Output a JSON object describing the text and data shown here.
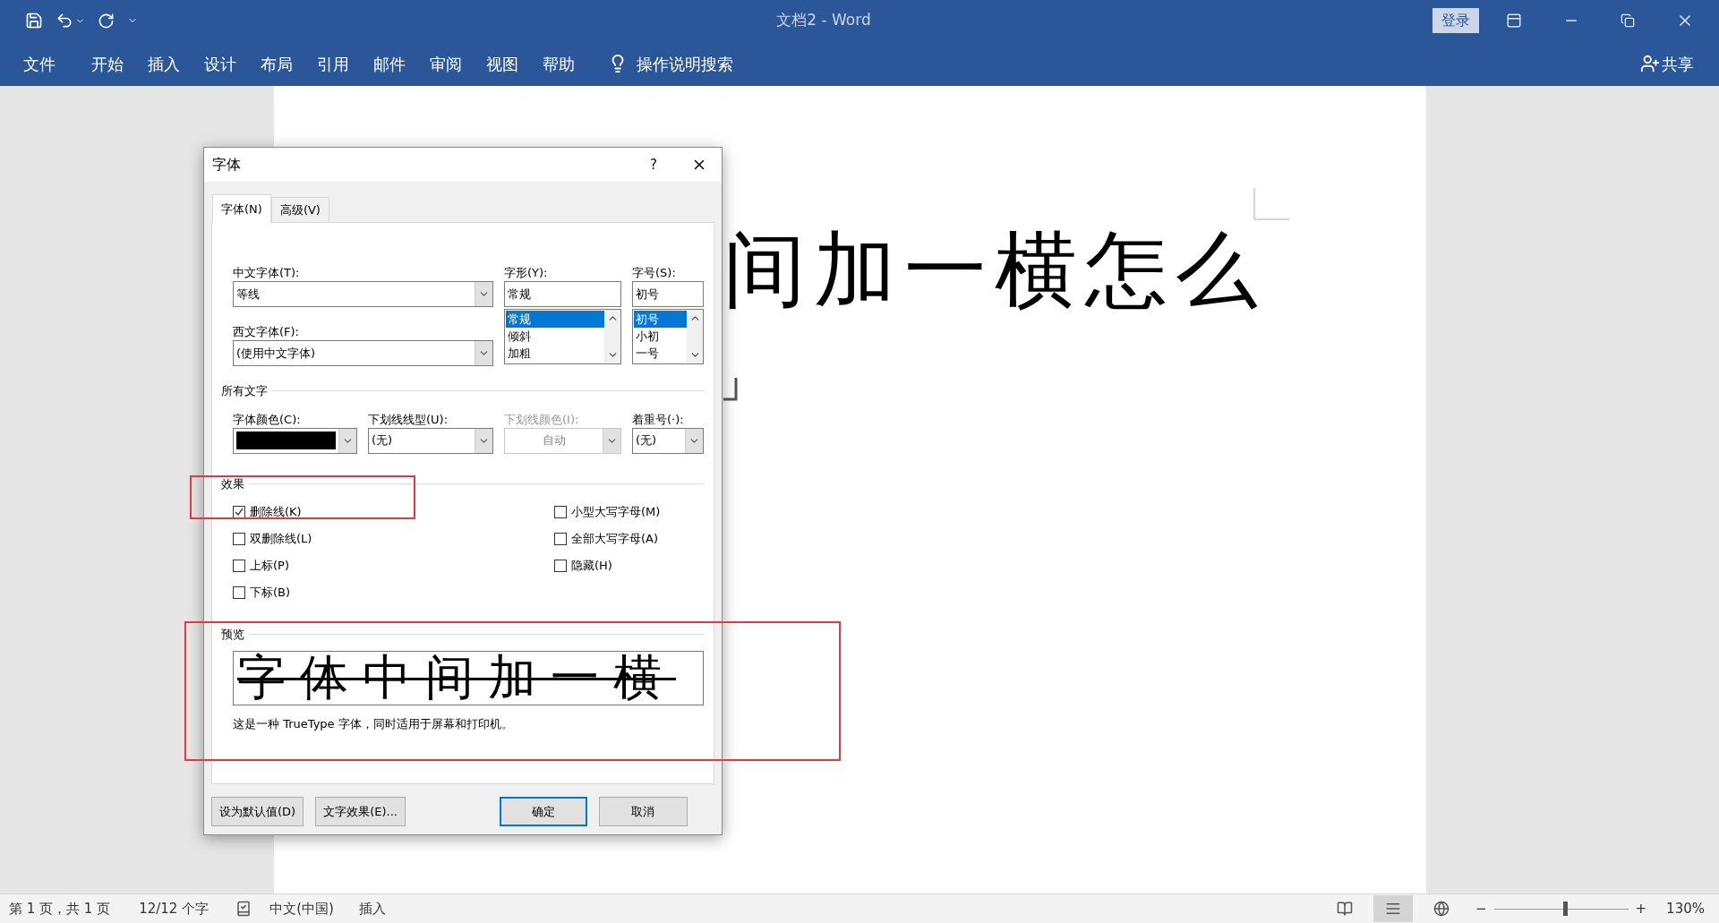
{
  "title_bar": {
    "title": "文档2  -  Word",
    "sign_in": "登录"
  },
  "ribbon": {
    "tabs": [
      "文件",
      "开始",
      "插入",
      "设计",
      "布局",
      "引用",
      "邮件",
      "审阅",
      "视图",
      "帮助"
    ],
    "tell_me": "操作说明搜索",
    "share": "共享"
  },
  "document": {
    "text": "间加一横怎么"
  },
  "dialog": {
    "title": "字体",
    "help": "?",
    "tabs": [
      {
        "label": "字体(N)",
        "selected": true
      },
      {
        "label": "高级(V)",
        "selected": false
      }
    ],
    "chinese_font": {
      "label": "中文字体(T):",
      "value": "等线"
    },
    "western_font": {
      "label": "西文字体(F):",
      "value": "(使用中文字体)"
    },
    "style": {
      "label": "字形(Y):",
      "value": "常规",
      "options": [
        {
          "label": "常规",
          "selected": true
        },
        {
          "label": "倾斜",
          "selected": false
        },
        {
          "label": "加粗",
          "selected": false
        }
      ]
    },
    "size": {
      "label": "字号(S):",
      "value": "初号",
      "options": [
        {
          "label": "初号",
          "selected": true
        },
        {
          "label": "小初",
          "selected": false
        },
        {
          "label": "一号",
          "selected": false
        }
      ]
    },
    "all_text": {
      "heading": "所有文字",
      "fields": [
        {
          "kind": "color",
          "label": "字体颜色(C):",
          "color": "#000000",
          "disabled": false
        },
        {
          "kind": "combo",
          "label": "下划线线型(U):",
          "value": "(无)",
          "disabled": false
        },
        {
          "kind": "combo",
          "label": "下划线颜色(I):",
          "value": "自动",
          "disabled": true
        },
        {
          "kind": "combo",
          "label": "着重号(·):",
          "value": "(无)",
          "disabled": false
        }
      ]
    },
    "effects": {
      "heading": "效果",
      "left": [
        {
          "label": "删除线(K)",
          "checked": true
        },
        {
          "label": "双删除线(L)",
          "checked": false
        },
        {
          "label": "上标(P)",
          "checked": false
        },
        {
          "label": "下标(B)",
          "checked": false
        }
      ],
      "right": [
        {
          "label": "小型大写字母(M)",
          "checked": false
        },
        {
          "label": "全部大写字母(A)",
          "checked": false
        },
        {
          "label": "隐藏(H)",
          "checked": false
        }
      ]
    },
    "preview": {
      "heading": "预览",
      "sample": "字体中间加一横",
      "strikethrough": true,
      "note": "这是一种 TrueType 字体，同时适用于屏幕和打印机。"
    },
    "buttons": [
      {
        "label": "设为默认值(D)",
        "default": false
      },
      {
        "label": "文字效果(E)...",
        "default": false
      },
      {
        "label": "确定",
        "default": true
      },
      {
        "label": "取消",
        "default": false
      }
    ]
  },
  "annotations": [
    {
      "color": "#e8383d"
    },
    {
      "color": "#e8383d"
    }
  ],
  "status_bar": {
    "page": "第 1 页，共 1 页",
    "words": "12/12 个字",
    "language": "中文(中国)",
    "mode": "插入",
    "views": [
      {
        "kind": "read",
        "selected": false
      },
      {
        "kind": "print",
        "selected": true
      },
      {
        "kind": "web",
        "selected": false
      }
    ],
    "zoom": {
      "minus": "−",
      "plus": "+",
      "level": 0.53,
      "reading": "130%"
    }
  }
}
